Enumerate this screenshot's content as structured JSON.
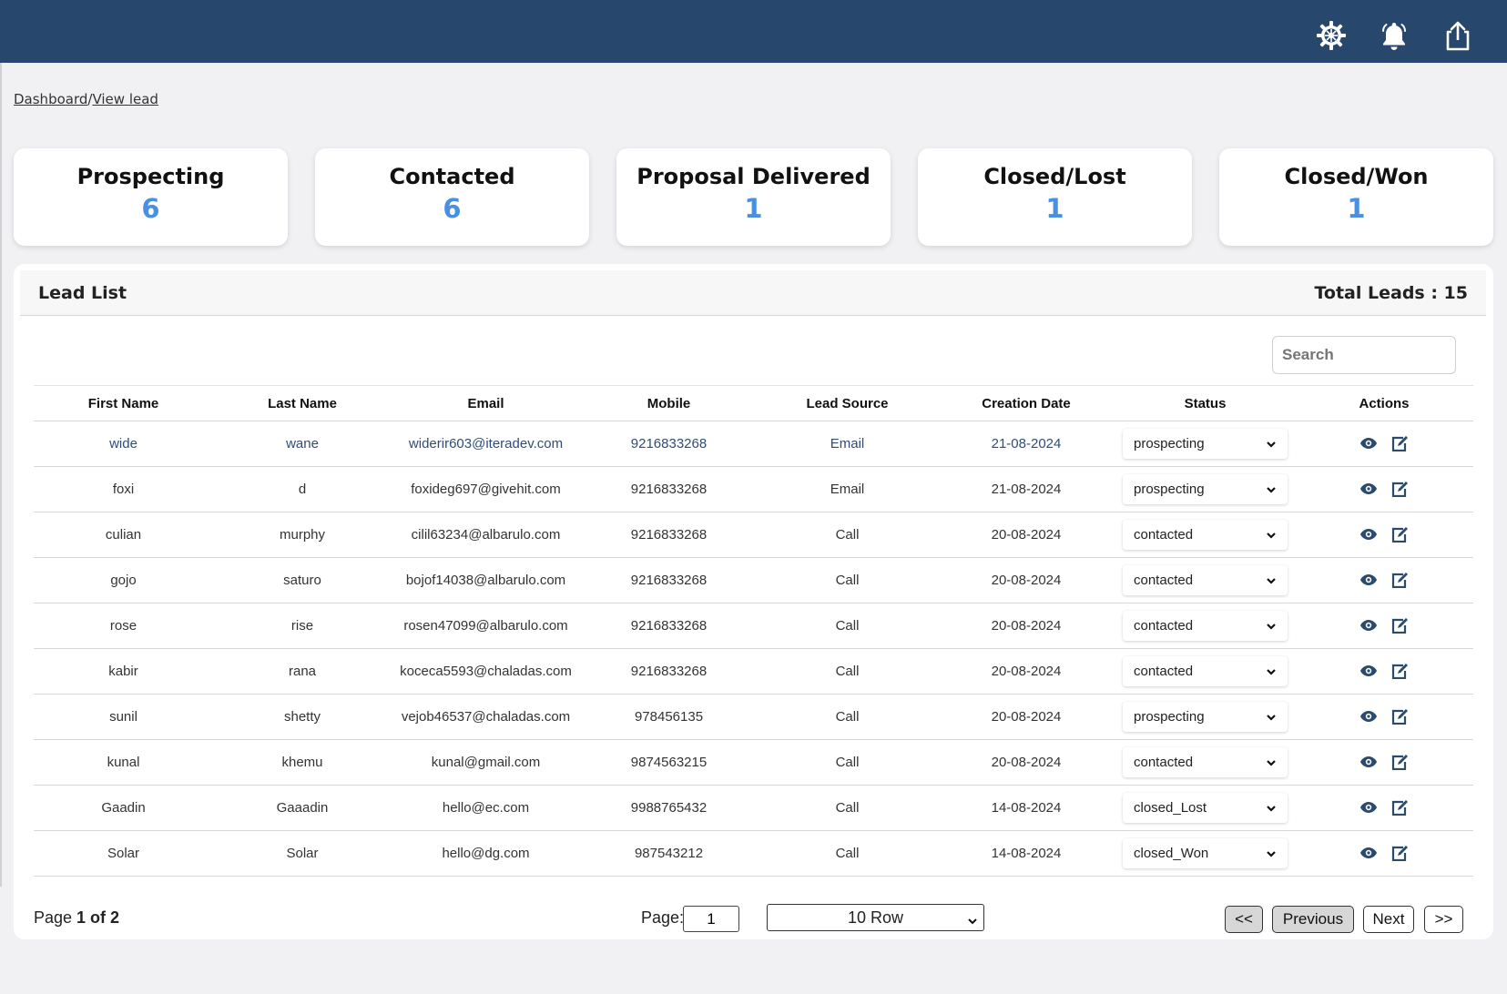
{
  "breadcrumb": {
    "home": "Dashboard",
    "sep": "/",
    "current": "View lead"
  },
  "cards": [
    {
      "title": "Prospecting",
      "value": "6"
    },
    {
      "title": "Contacted",
      "value": "6"
    },
    {
      "title": "Proposal Delivered",
      "value": "1"
    },
    {
      "title": "Closed/Lost",
      "value": "1"
    },
    {
      "title": "Closed/Won",
      "value": "1"
    }
  ],
  "panel": {
    "title": "Lead List",
    "total": "Total Leads : 15"
  },
  "search": {
    "placeholder": "Search"
  },
  "table": {
    "headers": [
      "First Name",
      "Last Name",
      "Email",
      "Mobile",
      "Lead Source",
      "Creation Date",
      "Status",
      "Actions"
    ],
    "rows": [
      {
        "first": "wide",
        "last": "wane",
        "email": "widerir603@iteradev.com",
        "mobile": "9216833268",
        "source": "Email",
        "date": "21-08-2024",
        "status": "prospecting"
      },
      {
        "first": "foxi",
        "last": "d",
        "email": "foxideg697@givehit.com",
        "mobile": "9216833268",
        "source": "Email",
        "date": "21-08-2024",
        "status": "prospecting"
      },
      {
        "first": "culian",
        "last": "murphy",
        "email": "cilil63234@albarulo.com",
        "mobile": "9216833268",
        "source": "Call",
        "date": "20-08-2024",
        "status": "contacted"
      },
      {
        "first": "gojo",
        "last": "saturo",
        "email": "bojof14038@albarulo.com",
        "mobile": "9216833268",
        "source": "Call",
        "date": "20-08-2024",
        "status": "contacted"
      },
      {
        "first": "rose",
        "last": "rise",
        "email": "rosen47099@albarulo.com",
        "mobile": "9216833268",
        "source": "Call",
        "date": "20-08-2024",
        "status": "contacted"
      },
      {
        "first": "kabir",
        "last": "rana",
        "email": "koceca5593@chaladas.com",
        "mobile": "9216833268",
        "source": "Call",
        "date": "20-08-2024",
        "status": "contacted"
      },
      {
        "first": "sunil",
        "last": "shetty",
        "email": "vejob46537@chaladas.com",
        "mobile": "978456135",
        "source": "Call",
        "date": "20-08-2024",
        "status": "prospecting"
      },
      {
        "first": "kunal",
        "last": "khemu",
        "email": "kunal@gmail.com",
        "mobile": "9874563215",
        "source": "Call",
        "date": "20-08-2024",
        "status": "contacted"
      },
      {
        "first": "Gaadin",
        "last": "Gaaadin",
        "email": "hello@ec.com",
        "mobile": "9988765432",
        "source": "Call",
        "date": "14-08-2024",
        "status": "closed_Lost"
      },
      {
        "first": "Solar",
        "last": "Solar",
        "email": "hello@dg.com",
        "mobile": "987543212",
        "source": "Call",
        "date": "14-08-2024",
        "status": "closed_Won"
      }
    ]
  },
  "pagination": {
    "page_word": "Page ",
    "page_of": "1 of 2",
    "page_label": "Page:",
    "page_value": "1",
    "rows_option": "10 Row",
    "first": "<<",
    "prev": "Previous",
    "next": "Next",
    "last": ">>"
  },
  "colors": {
    "topbar": "#27486c",
    "card_value": "#4a90e2",
    "highlight_row_text": "#2f4d77"
  },
  "icons": {
    "settings": "gear-icon",
    "notifications": "bell-icon",
    "share": "share-icon",
    "view": "eye-icon",
    "edit": "edit-icon"
  }
}
